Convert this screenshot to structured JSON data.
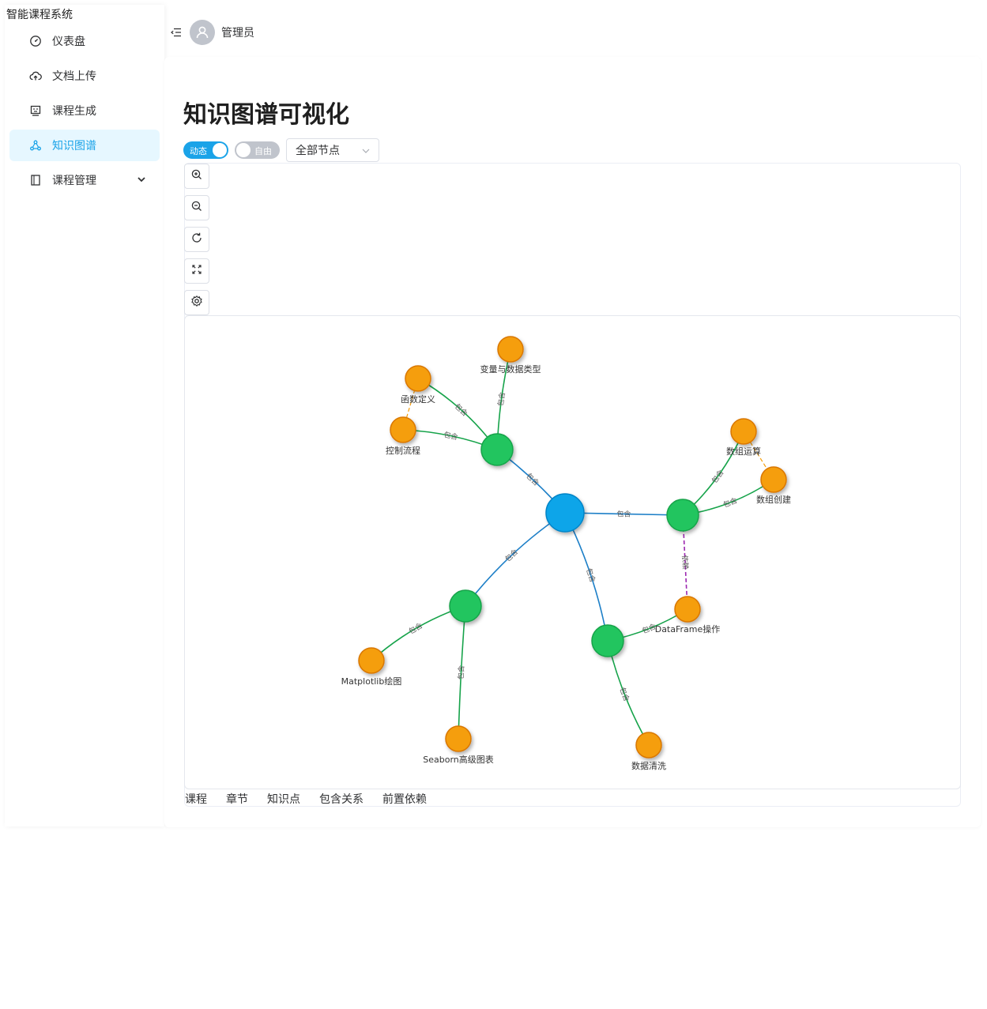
{
  "app": {
    "title": "智能课程系统"
  },
  "sidebar": {
    "items": [
      {
        "label": "仪表盘",
        "icon": "dashboard-icon"
      },
      {
        "label": "文档上传",
        "icon": "cloud-upload-icon"
      },
      {
        "label": "课程生成",
        "icon": "course-generate-icon"
      },
      {
        "label": "知识图谱",
        "icon": "graph-icon",
        "active": true
      },
      {
        "label": "课程管理",
        "icon": "book-icon",
        "expandable": true
      }
    ]
  },
  "header": {
    "user": "管理员"
  },
  "page": {
    "title": "知识图谱可视化"
  },
  "controls": {
    "dynamic_switch": {
      "label": "动态",
      "on": true
    },
    "free_switch": {
      "label": "自由",
      "on": false
    },
    "node_filter": "全部节点"
  },
  "toolbar": [
    "zoom-in-icon",
    "zoom-out-icon",
    "refresh-icon",
    "fit-view-icon",
    "settings-icon"
  ],
  "legend": [
    "课程",
    "章节",
    "知识点",
    "包含关系",
    "前置依赖"
  ],
  "colors": {
    "course": "#0ea5e9",
    "chapter": "#22c55e",
    "point": "#f59e0b",
    "contains_course": "#1d7fc7",
    "contains_chapter": "#16a34a",
    "prereq_chapter": "#9c27b0",
    "prereq_point": "#f59e0b",
    "accent": "#1aa3e8"
  },
  "graph": {
    "nodes": [
      {
        "id": "course",
        "type": "course",
        "label": ""
      },
      {
        "id": "ch1",
        "type": "chapter",
        "label": ""
      },
      {
        "id": "ch2",
        "type": "chapter",
        "label": ""
      },
      {
        "id": "ch3",
        "type": "chapter",
        "label": ""
      },
      {
        "id": "ch4",
        "type": "chapter",
        "label": ""
      },
      {
        "id": "p_var",
        "type": "point",
        "label": "变量与数据类型"
      },
      {
        "id": "p_func",
        "type": "point",
        "label": "函数定义"
      },
      {
        "id": "p_ctrl",
        "type": "point",
        "label": "控制流程"
      },
      {
        "id": "p_arrop",
        "type": "point",
        "label": "数组运算"
      },
      {
        "id": "p_arrcreate",
        "type": "point",
        "label": "数组创建"
      },
      {
        "id": "p_df",
        "type": "point",
        "label": "DataFrame操作"
      },
      {
        "id": "p_clean",
        "type": "point",
        "label": "数据清洗"
      },
      {
        "id": "p_mpl",
        "type": "point",
        "label": "Matplotlib绘图"
      },
      {
        "id": "p_sns",
        "type": "point",
        "label": "Seaborn高级图表"
      }
    ],
    "edges": [
      {
        "source": "course",
        "target": "ch1",
        "label": "包含",
        "kind": "contains_course"
      },
      {
        "source": "course",
        "target": "ch2",
        "label": "包含",
        "kind": "contains_course"
      },
      {
        "source": "course",
        "target": "ch3",
        "label": "包含",
        "kind": "contains_course"
      },
      {
        "source": "course",
        "target": "ch4",
        "label": "包含",
        "kind": "contains_course"
      },
      {
        "source": "ch1",
        "target": "p_var",
        "label": "包含",
        "kind": "contains_chapter"
      },
      {
        "source": "ch1",
        "target": "p_func",
        "label": "包含",
        "kind": "contains_chapter"
      },
      {
        "source": "ch1",
        "target": "p_ctrl",
        "label": "包含",
        "kind": "contains_chapter"
      },
      {
        "source": "ch2",
        "target": "p_arrop",
        "label": "包含",
        "kind": "contains_chapter"
      },
      {
        "source": "ch2",
        "target": "p_arrcreate",
        "label": "包含",
        "kind": "contains_chapter"
      },
      {
        "source": "ch3",
        "target": "p_df",
        "label": "包含",
        "kind": "contains_chapter"
      },
      {
        "source": "ch3",
        "target": "p_clean",
        "label": "包含",
        "kind": "contains_chapter"
      },
      {
        "source": "ch4",
        "target": "p_mpl",
        "label": "包含",
        "kind": "contains_chapter"
      },
      {
        "source": "ch4",
        "target": "p_sns",
        "label": "包含",
        "kind": "contains_chapter"
      },
      {
        "source": "ch2",
        "target": "p_df",
        "label": "依赖",
        "kind": "prereq_chapter"
      },
      {
        "source": "p_ctrl",
        "target": "p_func",
        "label": "依赖",
        "kind": "prereq_point"
      },
      {
        "source": "p_arrop",
        "target": "p_arrcreate",
        "label": "依赖",
        "kind": "prereq_point"
      }
    ]
  }
}
